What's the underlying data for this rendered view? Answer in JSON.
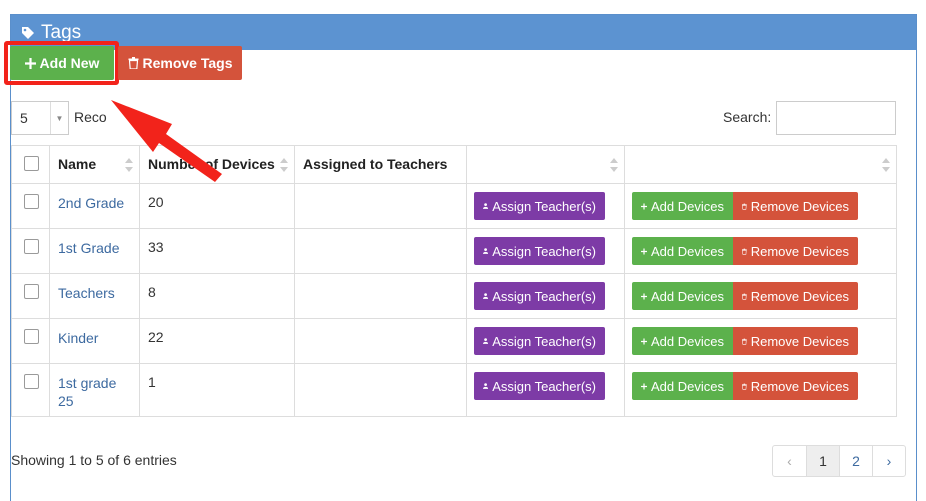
{
  "header": {
    "title": "Tags",
    "icon": "tag-icon"
  },
  "toolbar": {
    "add_new": "Add New",
    "remove_tags": "Remove Tags"
  },
  "length": {
    "value": "5",
    "label": "Reco"
  },
  "search": {
    "label": "Search:",
    "value": ""
  },
  "table": {
    "columns": [
      "Name",
      "Number of Devices",
      "Assigned to Teachers",
      "",
      ""
    ],
    "rows": [
      {
        "name": "2nd Grade",
        "devices": "20",
        "teachers": ""
      },
      {
        "name": "1st Grade",
        "devices": "33",
        "teachers": ""
      },
      {
        "name": "Teachers",
        "devices": "8",
        "teachers": ""
      },
      {
        "name": "Kinder",
        "devices": "22",
        "teachers": ""
      },
      {
        "name": "1st grade 25",
        "devices": "1",
        "teachers": ""
      }
    ],
    "assign_label": "Assign Teacher(s)",
    "add_devices_label": "Add Devices",
    "remove_devices_label": "Remove Devices"
  },
  "footer": {
    "info": "Showing 1 to 5 of 6 entries"
  },
  "pagination": {
    "prev": "‹",
    "pages": [
      "1",
      "2"
    ],
    "next": "›"
  },
  "colors": {
    "header": "#5c93d1",
    "success": "#5cb14c",
    "danger": "#d4533b",
    "purple": "#7d3ba6",
    "annotation": "#f2231b"
  }
}
